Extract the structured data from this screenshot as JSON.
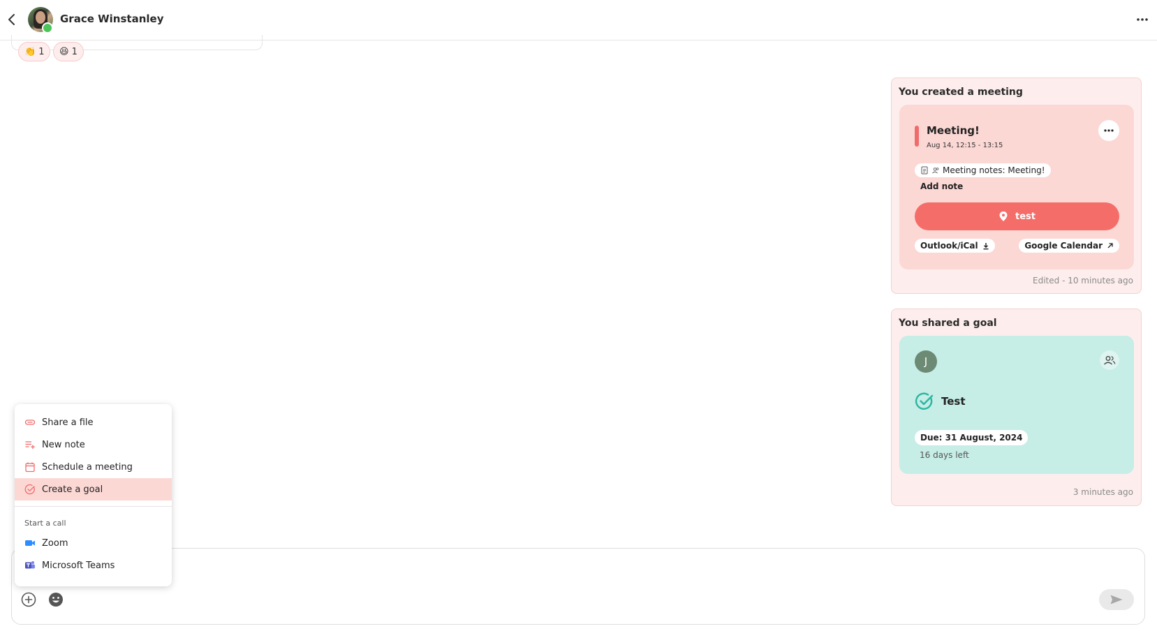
{
  "header": {
    "contact_name": "Grace Winstanley",
    "back_icon": "chevron-left-icon",
    "more_icon": "more-horizontal-icon"
  },
  "reactions": [
    {
      "emoji": "👏",
      "count": "1"
    },
    {
      "emoji": "😆",
      "count": "1"
    }
  ],
  "meeting_card": {
    "title": "You created a meeting",
    "meeting_name": "Meeting!",
    "time": "Aug 14, 12:15 - 13:15",
    "notes_label": "Meeting notes: Meeting!",
    "add_note": "Add note",
    "location": "test",
    "outlook_label": "Outlook/iCal",
    "google_label": "Google Calendar",
    "footer": "Edited - 10 minutes ago",
    "accent_color": "#f56d69"
  },
  "goal_card": {
    "title": "You shared a goal",
    "avatar_initial": "J",
    "goal_name": "Test",
    "due": "Due: 31 August, 2024",
    "days_left": "16 days left",
    "footer": "3 minutes ago",
    "accent_color": "#2bb5a0"
  },
  "menu": {
    "items": [
      {
        "label": "Share a file",
        "icon": "paperclip-icon"
      },
      {
        "label": "New note",
        "icon": "note-add-icon"
      },
      {
        "label": "Schedule a meeting",
        "icon": "calendar-icon"
      },
      {
        "label": "Create a goal",
        "icon": "goal-check-icon"
      }
    ],
    "call_section": "Start a call",
    "call_items": [
      {
        "label": "Zoom",
        "icon": "zoom-icon"
      },
      {
        "label": "Microsoft Teams",
        "icon": "teams-icon"
      }
    ]
  },
  "composer": {
    "add_icon": "plus-circle-icon",
    "emoji_icon": "emoji-icon",
    "send_icon": "send-icon"
  }
}
